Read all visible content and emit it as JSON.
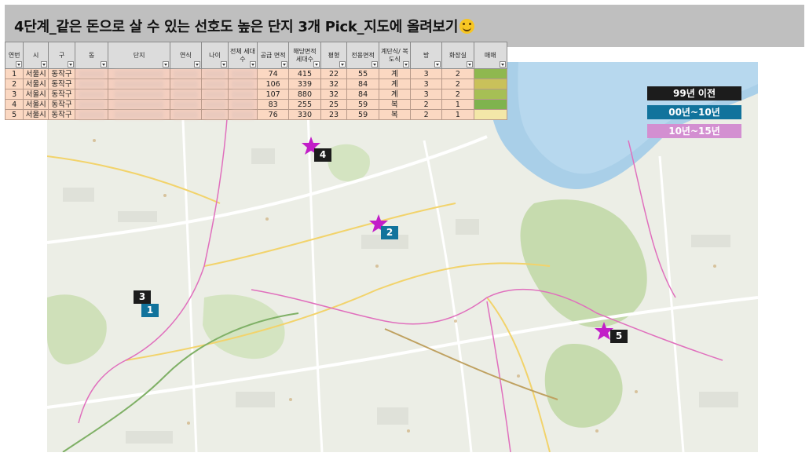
{
  "title": "4단계_같은 돈으로 살 수 있는 선호도 높은 단지 3개 Pick_지도에 올려보기",
  "title_emoji": "smiling-face-emoji",
  "sheet": {
    "headers": [
      "연번",
      "시",
      "구",
      "동",
      "단지",
      "연식",
      "나이",
      "전체 세대수",
      "공급 면적",
      "해당면적 세대수",
      "평형",
      "전용면적",
      "계단식/ 복도식",
      "방",
      "화장실",
      "매매"
    ],
    "rows": [
      {
        "no": "1",
        "city": "서울시",
        "gu": "동작구",
        "supply": "74",
        "households": "415",
        "pyeong": "22",
        "exclusive": "55",
        "type": "계",
        "rooms": "3",
        "baths": "2"
      },
      {
        "no": "2",
        "city": "서울시",
        "gu": "동작구",
        "supply": "106",
        "households": "339",
        "pyeong": "32",
        "exclusive": "84",
        "type": "계",
        "rooms": "3",
        "baths": "2"
      },
      {
        "no": "3",
        "city": "서울시",
        "gu": "동작구",
        "supply": "107",
        "households": "880",
        "pyeong": "32",
        "exclusive": "84",
        "type": "계",
        "rooms": "3",
        "baths": "2"
      },
      {
        "no": "4",
        "city": "서울시",
        "gu": "동작구",
        "supply": "83",
        "households": "255",
        "pyeong": "25",
        "exclusive": "59",
        "type": "복",
        "rooms": "2",
        "baths": "1"
      },
      {
        "no": "5",
        "city": "서울시",
        "gu": "동작구",
        "supply": "76",
        "households": "330",
        "pyeong": "23",
        "exclusive": "59",
        "type": "복",
        "rooms": "2",
        "baths": "1"
      }
    ]
  },
  "legend": {
    "before_99": "99년 이전",
    "y00_10": "00년~10년",
    "y10_15": "10년~15년"
  },
  "markers": [
    {
      "label": "1",
      "color": "blue"
    },
    {
      "label": "2",
      "color": "blue"
    },
    {
      "label": "3",
      "color": "black"
    },
    {
      "label": "4",
      "color": "black"
    },
    {
      "label": "5",
      "color": "black"
    }
  ],
  "colors": {
    "legend_black": "#1c1c1c",
    "legend_blue": "#11739c",
    "legend_pink": "#d38fd1",
    "star": "#c21ec8",
    "river": "#aacfe8",
    "park": "#c7dcb0",
    "table_row": "#fbd8c2",
    "table_header": "#dcdcdc"
  }
}
